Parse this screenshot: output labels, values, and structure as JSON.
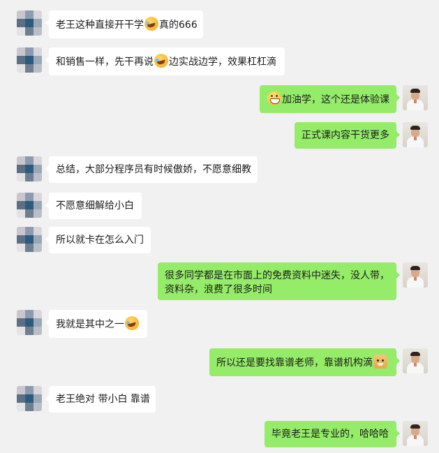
{
  "messages": [
    {
      "side": "left",
      "avatar": "mosaic",
      "parts": [
        {
          "t": "老王这种直接开干学"
        },
        {
          "e": "laugh-cry-emoji"
        },
        {
          "t": "真的666"
        }
      ]
    },
    {
      "side": "left",
      "avatar": "mosaic",
      "parts": [
        {
          "t": "和销售一样，先干再说"
        },
        {
          "e": "laugh-cry-emoji"
        },
        {
          "t": "边实战边学，效果杠杠滴"
        }
      ]
    },
    {
      "side": "right",
      "avatar": "photo",
      "parts": [
        {
          "e": "grin-emoji"
        },
        {
          "t": "加油学，这个还是体验课"
        }
      ]
    },
    {
      "side": "right",
      "avatar": "photo",
      "parts": [
        {
          "t": "正式课内容干货更多"
        }
      ]
    },
    {
      "side": "left",
      "avatar": "mosaic",
      "parts": [
        {
          "t": "总结，大部分程序员有时候傲娇，不愿意细教"
        }
      ]
    },
    {
      "side": "left",
      "avatar": "mosaic",
      "parts": [
        {
          "t": "不愿意细解给小白"
        }
      ]
    },
    {
      "side": "left",
      "avatar": "mosaic",
      "parts": [
        {
          "t": "所以就卡在怎么入门"
        }
      ]
    },
    {
      "side": "right",
      "avatar": "photo",
      "parts": [
        {
          "t": "很多同学都是在市面上的免费资料中迷失，没人带，资料杂，浪费了很多时间"
        }
      ]
    },
    {
      "side": "left",
      "avatar": "mosaic",
      "parts": [
        {
          "t": "我就是其中之一"
        },
        {
          "e": "laugh-cry-emoji"
        }
      ]
    },
    {
      "side": "right",
      "avatar": "photo",
      "parts": [
        {
          "t": "所以还是要找靠谱老师，靠谱机构滴"
        },
        {
          "e": "doge-emoji"
        }
      ]
    },
    {
      "side": "left",
      "avatar": "mosaic",
      "parts": [
        {
          "t": "老王绝对 带小白 靠谱"
        }
      ]
    },
    {
      "side": "right",
      "avatar": "photo",
      "parts": [
        {
          "t": "毕竟老王是专业的，哈哈哈"
        }
      ]
    }
  ],
  "colors": {
    "background": "#f1f1f1",
    "sent_bubble": "#95ec69",
    "received_bubble": "#ffffff"
  }
}
